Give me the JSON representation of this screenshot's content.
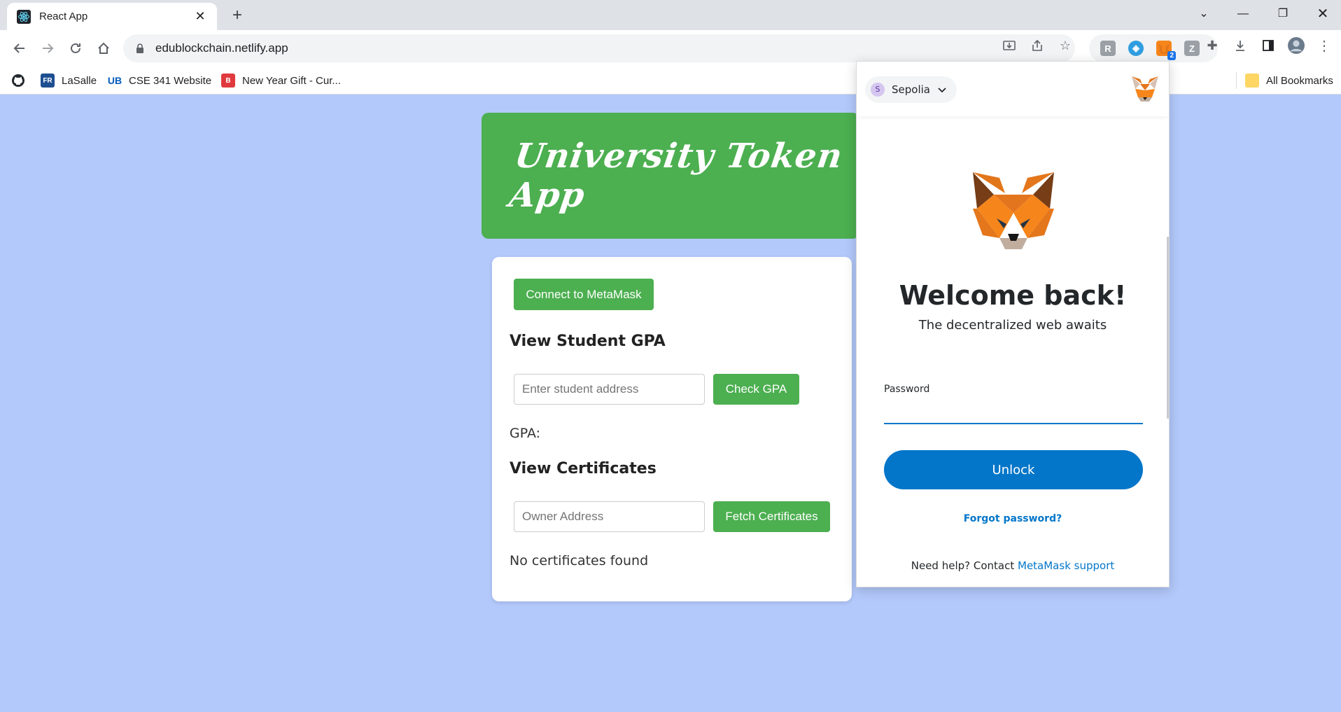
{
  "browser": {
    "tab_title": "React App",
    "url": "edublockchain.netlify.app",
    "bookmarks": [
      "LaSalle",
      "CSE 341 Website",
      "New Year Gift - Cur..."
    ],
    "all_bookmarks_label": "All Bookmarks",
    "metamask_badge": "2"
  },
  "app": {
    "title": "University Token App",
    "connect_button": "Connect to MetaMask",
    "gpa_section_title": "View Student GPA",
    "student_address_placeholder": "Enter student address",
    "check_gpa_button": "Check GPA",
    "gpa_label": "GPA:",
    "certificates_section_title": "View Certificates",
    "owner_address_placeholder": "Owner Address",
    "fetch_certificates_button": "Fetch Certificates",
    "certificates_status": "No certificates found"
  },
  "metamask": {
    "network_initial": "S",
    "network_name": "Sepolia",
    "welcome": "Welcome back!",
    "subtitle": "The decentralized web awaits",
    "password_label": "Password",
    "unlock_button": "Unlock",
    "forgot_password": "Forgot password?",
    "help_prefix": "Need help? Contact ",
    "help_link": "MetaMask support"
  },
  "colors": {
    "page_background": "#b3c9fb",
    "app_green": "#4caf50",
    "metamask_blue": "#0376c9"
  }
}
